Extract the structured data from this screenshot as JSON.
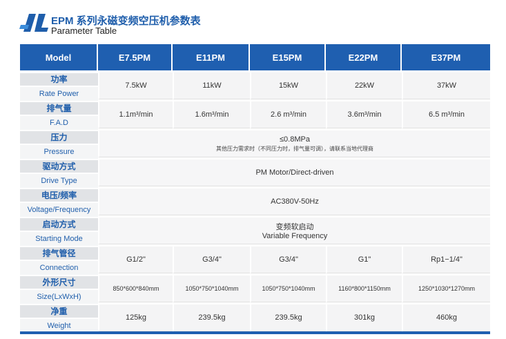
{
  "brand": {
    "title_cn": "EPM 系列永磁变频空压机参数表",
    "title_en": "Parameter Table",
    "accent_color": "#1f5fb0"
  },
  "table": {
    "header_label": "Model",
    "models": [
      "E7.5PM",
      "E11PM",
      "E15PM",
      "E22PM",
      "E37PM"
    ],
    "rows": {
      "power": {
        "cn": "功率",
        "en": "Rate Power",
        "values": [
          "7.5kW",
          "11kW",
          "15kW",
          "22kW",
          "37kW"
        ]
      },
      "fad": {
        "cn": "排气量",
        "en": "F.A.D",
        "values": [
          "1.1m³/min",
          "1.6m³/min",
          "2.6 m³/min",
          "3.6m³/min",
          "6.5 m³/min"
        ]
      },
      "pressure": {
        "cn": "压力",
        "en": "Pressure",
        "value": "≤0.8MPa",
        "note": "其他压力需求时（不同压力时，排气量可调），请联系当地代理商"
      },
      "drive": {
        "cn": "驱动方式",
        "en": "Drive Type",
        "value": "PM Motor/Direct-driven"
      },
      "voltage": {
        "cn": "电压/频率",
        "en": "Voltage/Frequency",
        "value": "AC380V-50Hz"
      },
      "starting": {
        "cn": "启动方式",
        "en": "Starting Mode",
        "value_cn": "变频软启动",
        "value_en": "Variable Frequency"
      },
      "connection": {
        "cn": "排气管径",
        "en": "Connection",
        "values": [
          "G1/2\"",
          "G3/4\"",
          "G3/4\"",
          "G1\"",
          "Rp1−1/4\""
        ]
      },
      "size": {
        "cn": "外形尺寸",
        "en": "Size(LxWxH)",
        "values": [
          "850*600*840mm",
          "1050*750*1040mm",
          "1050*750*1040mm",
          "1160*800*1150mm",
          "1250*1030*1270mm"
        ]
      },
      "weight": {
        "cn": "净重",
        "en": "Weight",
        "values": [
          "125kg",
          "239.5kg",
          "239.5kg",
          "301kg",
          "460kg"
        ]
      }
    }
  }
}
